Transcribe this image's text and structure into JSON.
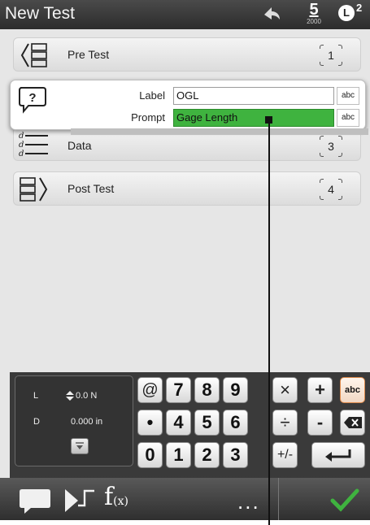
{
  "window": {
    "title": "New Test"
  },
  "status": {
    "s_label": "5",
    "s_sub": "2000",
    "l_label": "L",
    "l_sup": "2"
  },
  "rows": [
    {
      "label": "Pre Test",
      "num": "1"
    },
    {
      "label": "Data",
      "num": "3"
    },
    {
      "label": "Post Test",
      "num": "4"
    }
  ],
  "popup": {
    "label_caption": "Label",
    "label_value": "OGL",
    "prompt_caption": "Prompt",
    "prompt_value": "Gage Length",
    "abc": "abc"
  },
  "readout": {
    "l_name": "L",
    "l_value": "0.0 N",
    "d_name": "D",
    "d_value": "0.000 in"
  },
  "keypad": {
    "row1": [
      "@",
      "7",
      "8",
      "9",
      "×",
      "+",
      "abc"
    ],
    "row2": [
      "•",
      "4",
      "5",
      "6",
      "÷",
      "-"
    ],
    "row3": [
      "0",
      "1",
      "2",
      "3",
      "+/-"
    ]
  },
  "bottom": {
    "fx": "f",
    "fx_sub": "(x)",
    "more": "..."
  },
  "colors": {
    "prompt_highlight": "#3fb33f",
    "confirm": "#3fb33f"
  }
}
